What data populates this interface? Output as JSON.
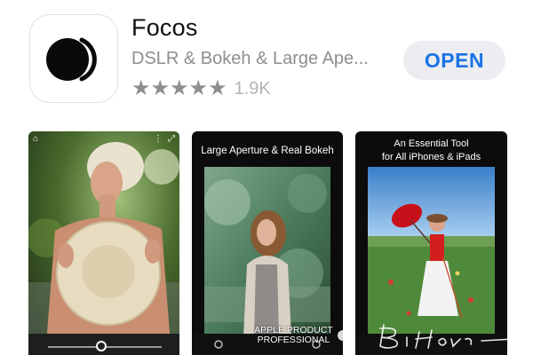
{
  "app": {
    "name": "Focos",
    "subtitle": "DSLR & Bokeh & Large Ape...",
    "stars": "★★★★★",
    "rating_value": 5,
    "rating_count": "1.9K",
    "open_label": "OPEN"
  },
  "screenshots": [
    {
      "caption": ""
    },
    {
      "caption": "Large Aperture & Real Bokeh"
    },
    {
      "caption": "An Essential Tool\nfor All iPhones & iPads"
    }
  ],
  "watermark": {
    "line1": "APPLE PRODUCT",
    "line2": "PROFESSIONAL"
  },
  "colors": {
    "accent": "#1a73e8",
    "button_bg": "#ececf1",
    "subtitle": "#8e8e93",
    "stars": "#8e8e93"
  },
  "icons": {
    "app_icon": "focos-aperture-icon",
    "shot1_top_left": "home-icon",
    "shot1_top_right": "more-icon"
  }
}
